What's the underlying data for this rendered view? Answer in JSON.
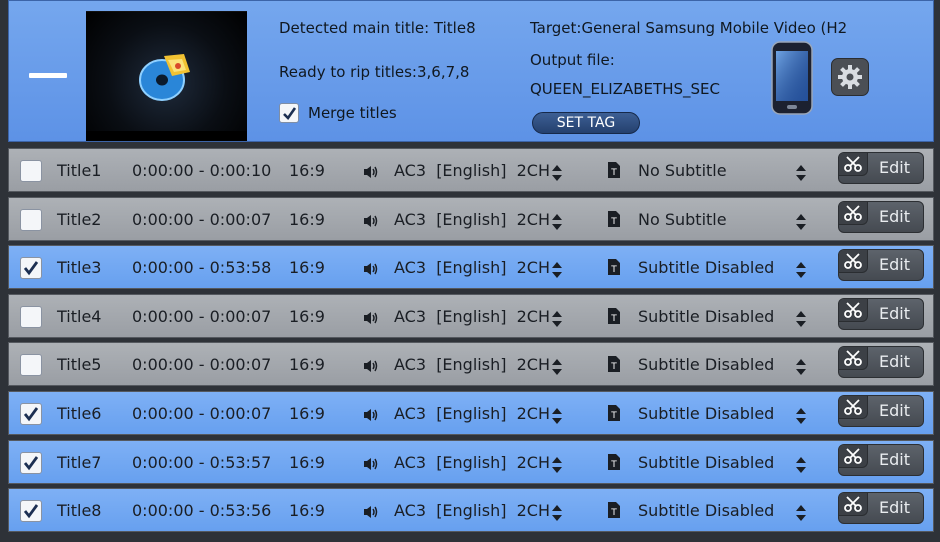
{
  "header": {
    "detected_main_title": "Detected main title: Title8",
    "ready_to_rip": "Ready to rip titles:3,6,7,8",
    "merge_titles_label": "Merge titles",
    "merge_titles_checked": true,
    "target": "Target:General Samsung Mobile Video (H2",
    "output_file_label": "Output file:",
    "output_file_value": "QUEEN_ELIZABETHS_SEC",
    "set_tag_label": "SET TAG",
    "icons": [
      "collapse-icon",
      "dvd-disc-icon",
      "checkmark-icon",
      "phone-icon",
      "gear-icon"
    ]
  },
  "titles": [
    {
      "checked": false,
      "name": "Title1",
      "duration": "0:00:00 - 0:00:10",
      "aspect": "16:9",
      "audio": "AC3  [English]  2CH",
      "subtitle": "No Subtitle",
      "edit_label": "Edit"
    },
    {
      "checked": false,
      "name": "Title2",
      "duration": "0:00:00 - 0:00:07",
      "aspect": "16:9",
      "audio": "AC3  [English]  2CH",
      "subtitle": "No Subtitle",
      "edit_label": "Edit"
    },
    {
      "checked": true,
      "name": "Title3",
      "duration": "0:00:00 - 0:53:58",
      "aspect": "16:9",
      "audio": "AC3  [English]  2CH",
      "subtitle": "Subtitle Disabled",
      "edit_label": "Edit"
    },
    {
      "checked": false,
      "name": "Title4",
      "duration": "0:00:00 - 0:00:07",
      "aspect": "16:9",
      "audio": "AC3  [English]  2CH",
      "subtitle": "Subtitle Disabled",
      "edit_label": "Edit"
    },
    {
      "checked": false,
      "name": "Title5",
      "duration": "0:00:00 - 0:00:07",
      "aspect": "16:9",
      "audio": "AC3  [English]  2CH",
      "subtitle": "Subtitle Disabled",
      "edit_label": "Edit"
    },
    {
      "checked": true,
      "name": "Title6",
      "duration": "0:00:00 - 0:00:07",
      "aspect": "16:9",
      "audio": "AC3  [English]  2CH",
      "subtitle": "Subtitle Disabled",
      "edit_label": "Edit"
    },
    {
      "checked": true,
      "name": "Title7",
      "duration": "0:00:00 - 0:53:57",
      "aspect": "16:9",
      "audio": "AC3  [English]  2CH",
      "subtitle": "Subtitle Disabled",
      "edit_label": "Edit"
    },
    {
      "checked": true,
      "name": "Title8",
      "duration": "0:00:00 - 0:53:56",
      "aspect": "16:9",
      "audio": "AC3  [English]  2CH",
      "subtitle": "Subtitle Disabled",
      "edit_label": "Edit"
    }
  ],
  "row_icons": [
    "checkbox-icon",
    "speaker-icon",
    "up-down-arrows-icon",
    "subtitle-icon",
    "scissors-icon"
  ],
  "colors": {
    "header_bg": "#6a9eea",
    "row_checked_bg": "#74aaf3",
    "row_unchecked_bg": "#a4a8ad",
    "edit_button_bg": "#50555c"
  }
}
